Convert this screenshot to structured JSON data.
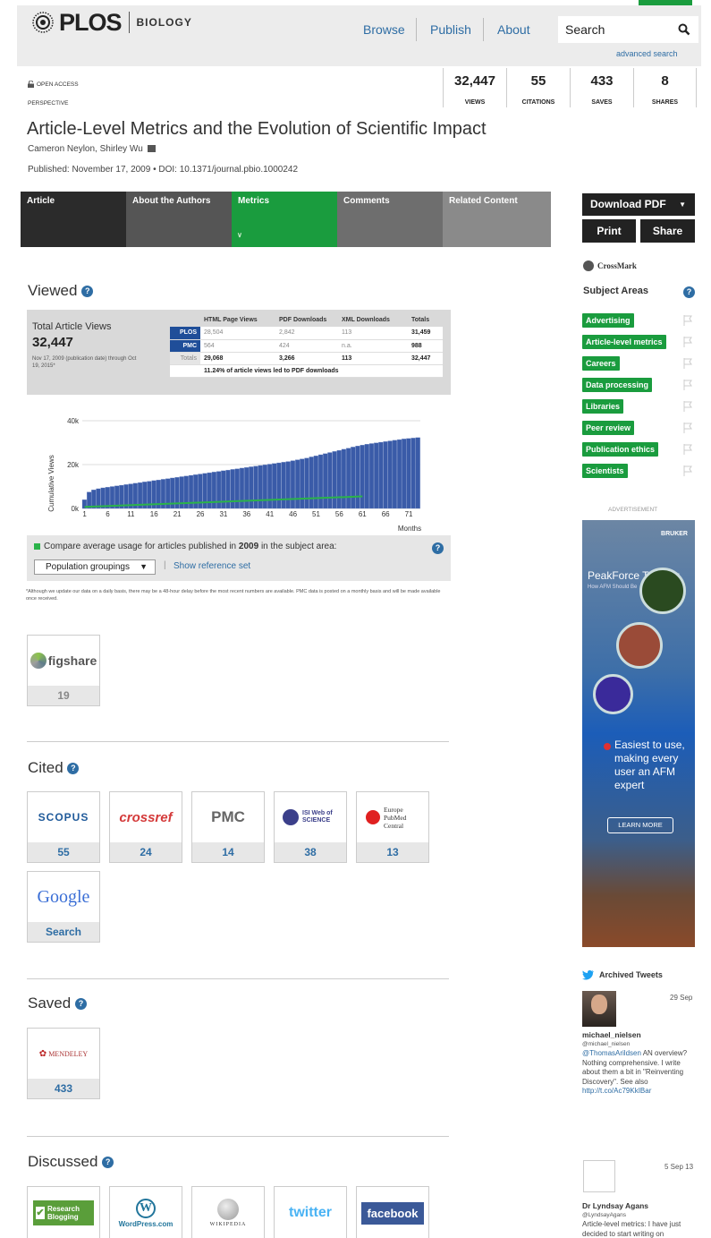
{
  "header": {
    "site": "PLOS",
    "journal": "BIOLOGY",
    "nav": [
      "Browse",
      "Publish",
      "About"
    ],
    "search_placeholder": "Search",
    "advanced_search": "advanced search"
  },
  "article": {
    "access": "OPEN ACCESS",
    "type": "PERSPECTIVE",
    "title": "Article-Level Metrics and the Evolution of Scientific Impact",
    "authors": "Cameron Neylon, Shirley Wu",
    "published": "Published: November 17, 2009",
    "doi": "DOI: 10.1371/journal.pbio.1000242"
  },
  "metrics": [
    {
      "value": "32,447",
      "label": "VIEWS"
    },
    {
      "value": "55",
      "label": "CITATIONS"
    },
    {
      "value": "433",
      "label": "SAVES"
    },
    {
      "value": "8",
      "label": "SHARES"
    }
  ],
  "tabs": [
    {
      "label": "Article",
      "active": false
    },
    {
      "label": "About the Authors",
      "active": false
    },
    {
      "label": "Metrics",
      "active": true
    },
    {
      "label": "Comments",
      "active": false
    },
    {
      "label": "Related Content",
      "active": false
    }
  ],
  "sidebar": {
    "download_pdf": "Download PDF",
    "print": "Print",
    "share": "Share",
    "crossmark": "CrossMark",
    "subject_areas_title": "Subject Areas",
    "subject_areas": [
      "Advertising",
      "Article-level metrics",
      "Careers",
      "Data processing",
      "Libraries",
      "Peer review",
      "Publication ethics",
      "Scientists"
    ],
    "advertisement_label": "ADVERTISEMENT",
    "ad": {
      "brand": "BRUKER",
      "product": "PeakForce Tapping",
      "tagline": "How AFM Should Be",
      "pitch": "Easiest to use, making every user an AFM expert",
      "cta": "LEARN MORE"
    },
    "tweets_title": "Archived Tweets",
    "tweets": [
      {
        "date": "29 Sep",
        "name": "michael_nielsen",
        "handle": "@michael_nielsen",
        "mention": "@ThomasArildsen",
        "text": "AN overview? Nothing comprehensive. I write about them a bit in \"Reinventing Discovery\". See also",
        "link": "http://t.co/Ac79KkIBar"
      },
      {
        "date": "5 Sep 13",
        "name": "Dr Lyndsay Agans",
        "handle": "@LyndsayAgans",
        "text": "Article-level metrics: I have just decided to start writing on"
      }
    ]
  },
  "viewed": {
    "heading": "Viewed",
    "total_title": "Total Article Views",
    "total": "32,447",
    "note": "Nov 17, 2009 (publication date) through Oct 19, 2015*",
    "columns": [
      "",
      "HTML Page Views",
      "PDF Downloads",
      "XML Downloads",
      "Totals"
    ],
    "rows": [
      [
        "PLOS",
        "28,504",
        "2,842",
        "113",
        "31,459"
      ],
      [
        "PMC",
        "564",
        "424",
        "n.a.",
        "988"
      ],
      [
        "Totals",
        "29,068",
        "3,266",
        "113",
        "32,447"
      ]
    ],
    "pdf_note": "11.24% of article views led to PDF downloads",
    "compare_text_pre": "Compare average usage for articles published in",
    "compare_year": "2009",
    "compare_text_post": "in the subject area:",
    "select_value": "Population groupings",
    "reference_link": "Show reference set",
    "disclaimer": "*Although we update our data on a daily basis, there may be a 48-hour delay before the most recent numbers are available. PMC data is posted on a monthly basis and will be made available once received."
  },
  "chart_data": {
    "type": "bar",
    "ylabel": "Cumulative Views",
    "xlabel": "Months",
    "ylim": [
      0,
      40000
    ],
    "yticks": [
      "0k",
      "20k",
      "40k"
    ],
    "xticks": [
      1,
      6,
      11,
      16,
      21,
      26,
      31,
      36,
      41,
      46,
      51,
      56,
      61,
      66,
      71
    ],
    "colors": {
      "bars": "#3a5ba8",
      "reference": "#2bb34a"
    },
    "series": [
      {
        "values": [
          4000,
          7500,
          8500,
          9000,
          9400,
          9700,
          10000,
          10300,
          10600,
          10900,
          11200,
          11500,
          11800,
          12100,
          12400,
          12700,
          13000,
          13300,
          13600,
          13900,
          14200,
          14500,
          14800,
          15100,
          15400,
          15700,
          16000,
          16300,
          16600,
          16900,
          17200,
          17500,
          17800,
          18100,
          18400,
          18700,
          19000,
          19300,
          19600,
          19900,
          20200,
          20500,
          20800,
          21100,
          21400,
          21800,
          22200,
          22600,
          23000,
          23500,
          24000,
          24500,
          25000,
          25500,
          26000,
          26500,
          27000,
          27500,
          28000,
          28500,
          28900,
          29300,
          29600,
          29900,
          30200,
          30500,
          30800,
          31100,
          31400,
          31700,
          31900,
          32100,
          32300
        ]
      },
      {
        "values": [
          700,
          5500
        ]
      }
    ]
  },
  "figshare": {
    "logo": "figshare",
    "count": "19"
  },
  "cited": {
    "heading": "Cited",
    "sources": [
      {
        "logo": "SCOPUS",
        "count": "55"
      },
      {
        "logo": "crossref",
        "count": "24"
      },
      {
        "logo": "PMC",
        "count": "14"
      },
      {
        "logo": "ISI Web of SCIENCE",
        "count": "38"
      },
      {
        "logo": "Europe PubMed Central",
        "count": "13"
      },
      {
        "logo": "Google",
        "count": "Search"
      }
    ]
  },
  "saved": {
    "heading": "Saved",
    "sources": [
      {
        "logo": "MENDELEY",
        "count": "433"
      }
    ]
  },
  "discussed": {
    "heading": "Discussed",
    "sources": [
      "Research Blogging",
      "WordPress.com",
      "WIKIPEDIA",
      "twitter",
      "facebook"
    ]
  }
}
